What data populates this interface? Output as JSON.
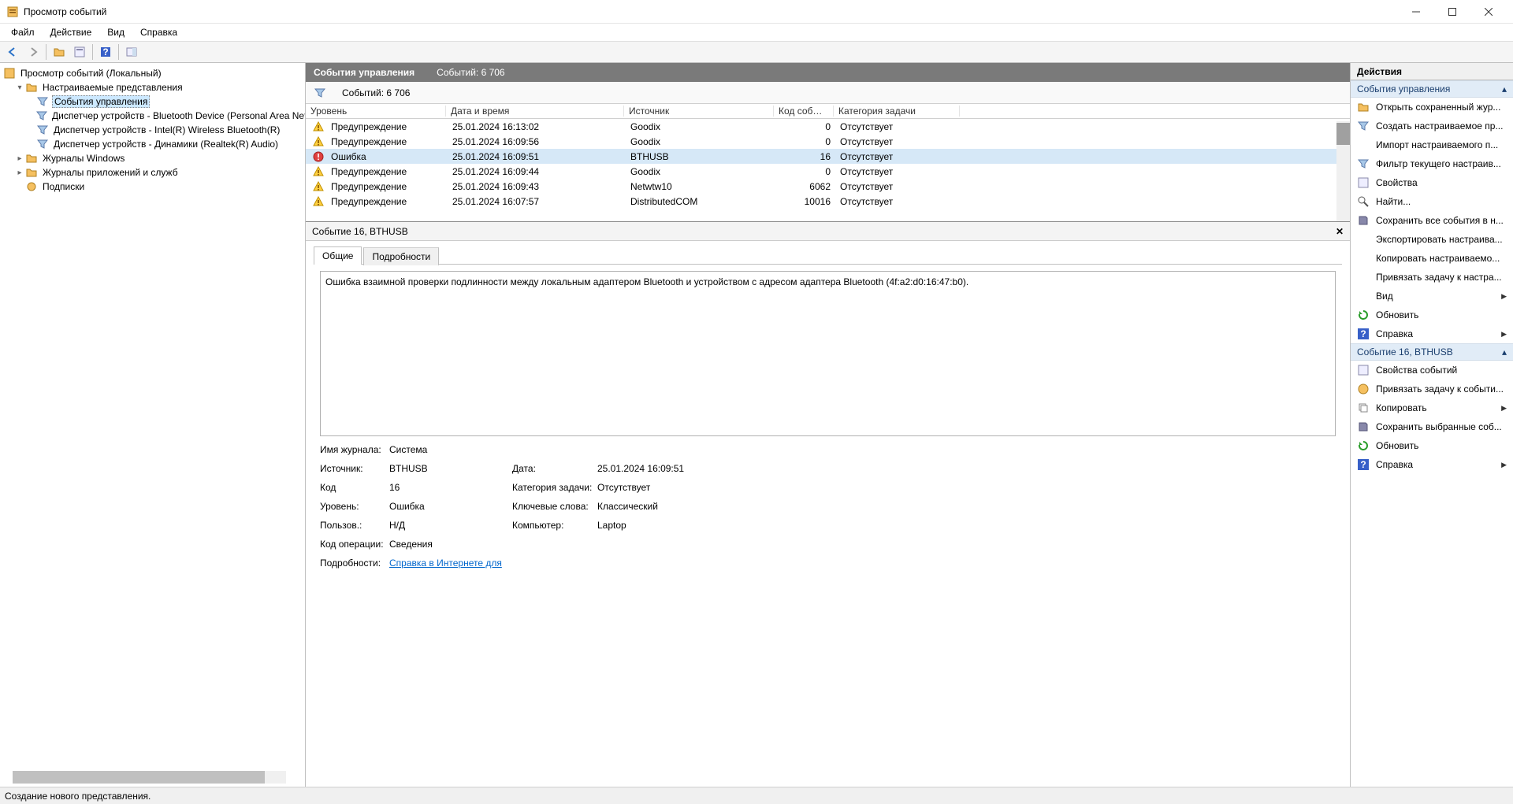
{
  "window": {
    "title": "Просмотр событий"
  },
  "menu": {
    "file": "Файл",
    "action": "Действие",
    "view": "Вид",
    "help": "Справка"
  },
  "tree": {
    "root": "Просмотр событий (Локальный)",
    "custom_views": "Настраиваемые представления",
    "mgmt_events": "События управления",
    "dm_bt": "Диспетчер устройств - Bluetooth Device (Personal Area Netw",
    "dm_wlan": "Диспетчер устройств - Intel(R) Wireless Bluetooth(R)",
    "dm_audio": "Диспетчер устройств - Динамики (Realtek(R) Audio)",
    "win_logs": "Журналы Windows",
    "app_logs": "Журналы приложений и служб",
    "subs": "Подписки"
  },
  "center": {
    "header_title": "События управления",
    "header_count": "Событий: 6 706",
    "filter_count": "Событий: 6 706",
    "detail_title": "Событие 16, BTHUSB",
    "tab_general": "Общие",
    "tab_details": "Подробности",
    "message": "Ошибка взаимной проверки подлинности между локальным адаптером Bluetooth и устройством с адресом адаптера Bluetooth (4f:a2:d0:16:47:b0).",
    "col": {
      "level": "Уровень",
      "date": "Дата и время",
      "source": "Источник",
      "code": "Код события",
      "cat": "Категория задачи"
    },
    "rows": [
      {
        "level": "Предупреждение",
        "icon": "warn",
        "date": "25.01.2024 16:13:02",
        "source": "Goodix",
        "code": "0",
        "cat": "Отсутствует"
      },
      {
        "level": "Предупреждение",
        "icon": "warn",
        "date": "25.01.2024 16:09:56",
        "source": "Goodix",
        "code": "0",
        "cat": "Отсутствует"
      },
      {
        "level": "Ошибка",
        "icon": "error",
        "date": "25.01.2024 16:09:51",
        "source": "BTHUSB",
        "code": "16",
        "cat": "Отсутствует",
        "selected": true
      },
      {
        "level": "Предупреждение",
        "icon": "warn",
        "date": "25.01.2024 16:09:44",
        "source": "Goodix",
        "code": "0",
        "cat": "Отсутствует"
      },
      {
        "level": "Предупреждение",
        "icon": "warn",
        "date": "25.01.2024 16:09:43",
        "source": "Netwtw10",
        "code": "6062",
        "cat": "Отсутствует"
      },
      {
        "level": "Предупреждение",
        "icon": "warn",
        "date": "25.01.2024 16:07:57",
        "source": "DistributedCOM",
        "code": "10016",
        "cat": "Отсутствует"
      }
    ],
    "props": {
      "log_label": "Имя журнала:",
      "log_val": "Система",
      "src_label": "Источник:",
      "src_val": "BTHUSB",
      "date_label": "Дата:",
      "date_val": "25.01.2024 16:09:51",
      "code_label": "Код",
      "code_val": "16",
      "cat_label": "Категория задачи:",
      "cat_val": "Отсутствует",
      "lvl_label": "Уровень:",
      "lvl_val": "Ошибка",
      "kw_label": "Ключевые слова:",
      "kw_val": "Классический",
      "user_label": "Пользов.:",
      "user_val": "Н/Д",
      "pc_label": "Компьютер:",
      "pc_val": "Laptop",
      "op_label": "Код операции:",
      "op_val": "Сведения",
      "more_label": "Подробности:",
      "more_link": "Справка в Интернете для "
    }
  },
  "actions": {
    "header": "Действия",
    "section1": "События управления",
    "open_saved": "Открыть сохраненный жур...",
    "create_view": "Создать настраиваемое пр...",
    "import_view": "Импорт настраиваемого п...",
    "filter_view": "Фильтр текущего настраив...",
    "properties": "Свойства",
    "find": "Найти...",
    "save_all": "Сохранить все события в н...",
    "export_view": "Экспортировать настраива...",
    "copy_view": "Копировать настраиваемо...",
    "attach_task_view": "Привязать задачу к настра...",
    "view": "Вид",
    "refresh": "Обновить",
    "help": "Справка",
    "section2": "Событие 16, BTHUSB",
    "evt_props": "Свойства событий",
    "attach_task_evt": "Привязать задачу к событи...",
    "copy": "Копировать",
    "save_selected": "Сохранить выбранные соб...",
    "refresh2": "Обновить",
    "help2": "Справка"
  },
  "status": "Создание нового представления."
}
